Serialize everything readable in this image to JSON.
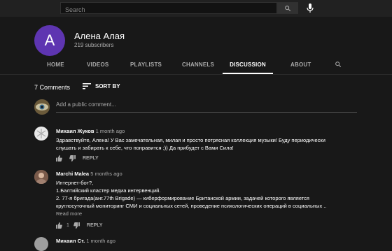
{
  "search": {
    "placeholder": "Search"
  },
  "channel": {
    "avatar_letter": "A",
    "name": "Алена Алая",
    "subscribers": "219 subscribers"
  },
  "tabs": [
    {
      "label": "HOME"
    },
    {
      "label": "VIDEOS"
    },
    {
      "label": "PLAYLISTS"
    },
    {
      "label": "CHANNELS"
    },
    {
      "label": "DISCUSSION",
      "active": true
    },
    {
      "label": "ABOUT"
    }
  ],
  "discussion": {
    "count": "7 Comments",
    "sort_label": "SORT BY",
    "add_placeholder": "Add a public comment..."
  },
  "comments": [
    {
      "author": "Михаил Жуков",
      "time": "1 month ago",
      "text_lines": [
        "Здравствуйте, Алена! У Вас замечательная, милая и просто потрясная коллекция музыки! Буду периодически",
        "слушать и забирать к себе, что понравится ;)) Да прибудет с Вами Сила!"
      ],
      "likes": "",
      "reply": "REPLY"
    },
    {
      "author": "Marchi Malea",
      "time": "5 months ago",
      "text_lines": [
        "Интернет-бот?,",
        "1.Балтийский кластер медиа интервенций.",
        "2. 77-я бригада(анг.77th Brigade) — киберформирование Британской армии, задачей которого является",
        "круглосуточный мониторинг СМИ и социальных сетей, проведение психологических операций в социальных .."
      ],
      "read_more": "Read more",
      "likes": "1",
      "reply": "REPLY"
    },
    {
      "author": "Михаил Ст.",
      "time": "1 month ago"
    }
  ],
  "colors": {
    "background": "#181818",
    "topbar": "#212121",
    "avatar": "#5e35b1"
  }
}
